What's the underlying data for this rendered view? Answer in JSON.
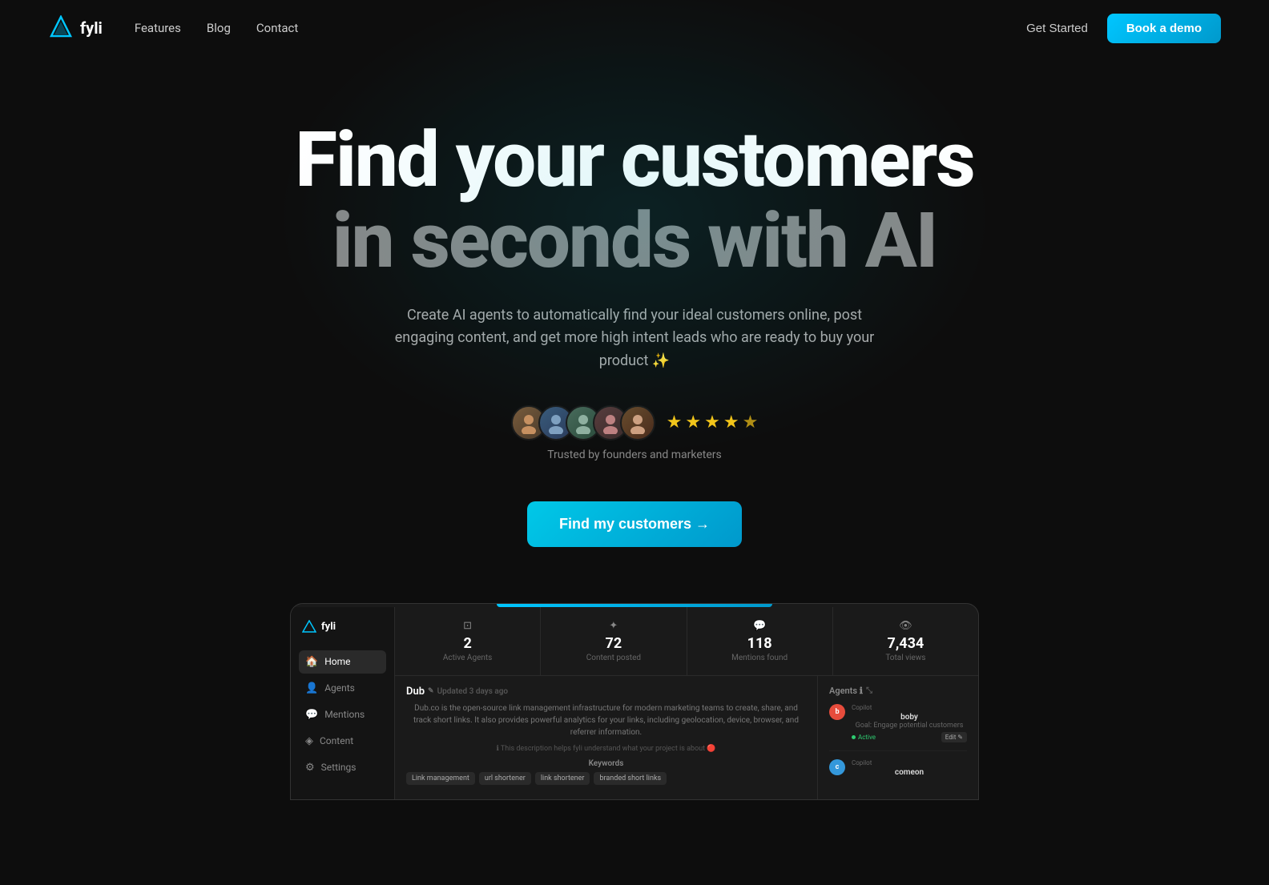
{
  "brand": {
    "name": "fyli",
    "logo_symbol": "▲"
  },
  "nav": {
    "links": [
      {
        "label": "Features",
        "id": "features"
      },
      {
        "label": "Blog",
        "id": "blog"
      },
      {
        "label": "Contact",
        "id": "contact"
      }
    ],
    "get_started": "Get Started",
    "book_demo": "Book a demo"
  },
  "hero": {
    "title_line1": "Find your customers",
    "title_line2": "in seconds with AI",
    "subtitle": "Create AI agents to automatically find your ideal customers online, post engaging content, and get more high intent leads who are ready to buy your product ✨",
    "trusted_text": "Trusted by founders and marketers",
    "cta_label": "Find my customers →",
    "stars": 4.5,
    "avatars": [
      "👤",
      "👤",
      "👤",
      "👤",
      "👤"
    ]
  },
  "dashboard": {
    "sidebar_items": [
      {
        "label": "Home",
        "icon": "🏠",
        "active": true
      },
      {
        "label": "Agents",
        "icon": "👤"
      },
      {
        "label": "Mentions",
        "icon": "💬"
      },
      {
        "label": "Content",
        "icon": "◈"
      },
      {
        "label": "Settings",
        "icon": "⚙"
      }
    ],
    "stats": [
      {
        "icon": "⊡",
        "value": "2",
        "label": "Active Agents"
      },
      {
        "icon": "✦",
        "value": "72",
        "label": "Content posted"
      },
      {
        "icon": "💬",
        "value": "118",
        "label": "Mentions found"
      },
      {
        "icon": "👁",
        "value": "7,434",
        "label": "Total views"
      }
    ],
    "project": {
      "name": "Dub",
      "updated": "Updated 3 days ago",
      "description": "Dub.co is the open-source link management infrastructure for modern marketing teams to create, share, and track short links. It also provides powerful analytics for your links, including geolocation, device, browser, and referrer information.",
      "note": "ℹ This description helps fyli understand what your project is about 🔴",
      "keywords_label": "Keywords",
      "tags": [
        "Link management",
        "url shortener",
        "link shortener",
        "branded short links"
      ]
    },
    "agents": {
      "title": "Agents ℹ",
      "items": [
        {
          "name": "boby",
          "avatar_text": "b",
          "avatar_color": "red",
          "goal": "Goal: Engage potential customers",
          "status": "Active",
          "copilot_label": "Copilot",
          "edit_label": "Edit ✎"
        },
        {
          "name": "comeon",
          "avatar_text": "c",
          "avatar_color": "blue",
          "copilot_label": "Copilot"
        }
      ]
    }
  }
}
